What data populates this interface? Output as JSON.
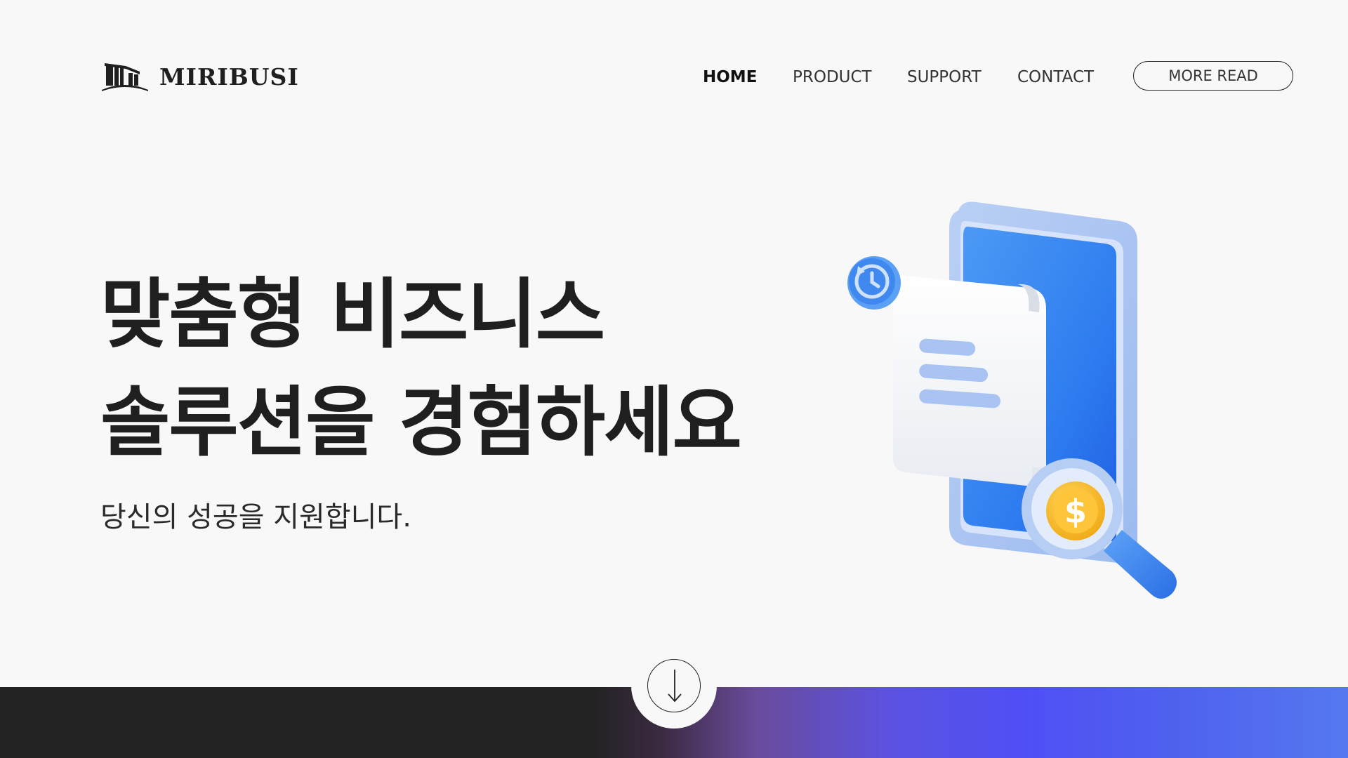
{
  "brand": {
    "name": "MIRIBUSI",
    "logo_icon": "building-pillars-icon"
  },
  "nav": {
    "items": [
      {
        "label": "HOME",
        "active": true
      },
      {
        "label": "PRODUCT",
        "active": false
      },
      {
        "label": "SUPPORT",
        "active": false
      },
      {
        "label": "CONTACT",
        "active": false
      }
    ],
    "cta_label": "MORE READ"
  },
  "hero": {
    "title_line1": "맞춤형 비즈니스",
    "title_line2": "솔루션을 경험하세요",
    "subtitle": "당신의 성공을 지원합니다.",
    "illustration_icon": "phone-receipt-magnifier-icon"
  },
  "scroll": {
    "icon": "arrow-down-icon"
  },
  "colors": {
    "background": "#f8f8f8",
    "text_primary": "#1f1f1f",
    "band_dark": "#232323",
    "band_accent": "#4f4ff5",
    "illustration_blue": "#3d8af0",
    "coin_gold": "#f5b82a"
  }
}
